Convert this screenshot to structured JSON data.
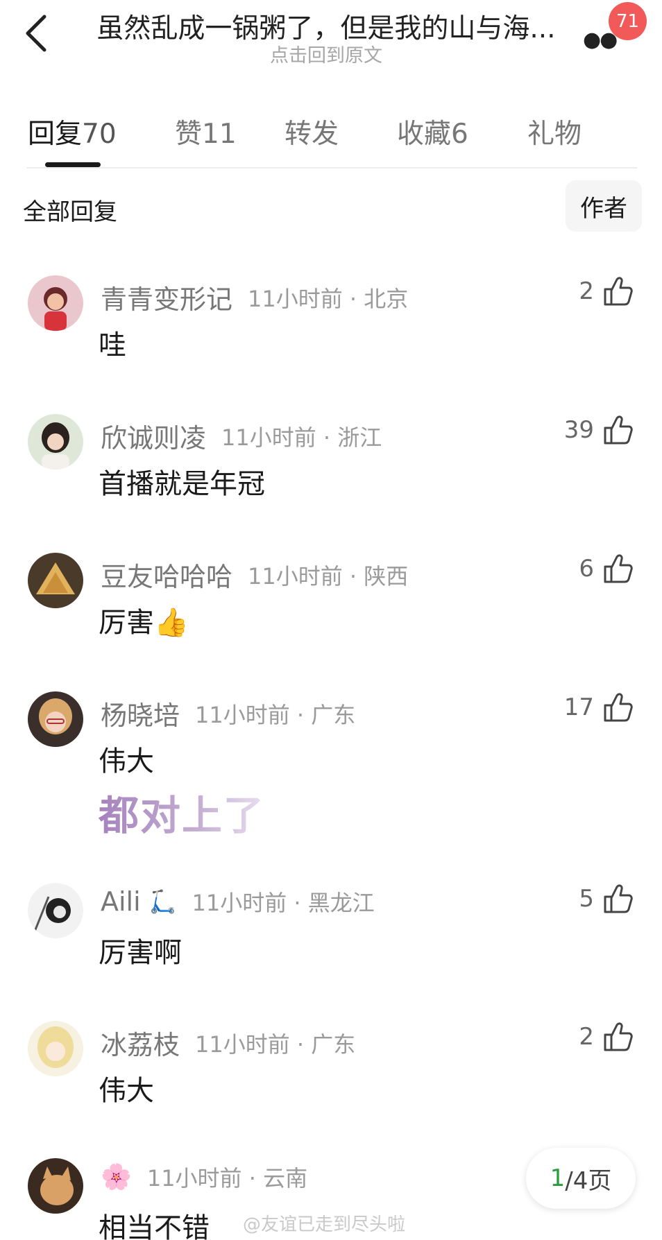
{
  "header": {
    "title": "虽然乱成一锅粥了，但是我的山与海...",
    "subtitle": "点击回到原文",
    "more_icon": "more-dots-icon",
    "notification_count": "71"
  },
  "tabs": [
    {
      "label": "回复",
      "count": "70"
    },
    {
      "label": "赞",
      "count": "11"
    },
    {
      "label": "转发",
      "count": ""
    },
    {
      "label": "收藏",
      "count": "6"
    },
    {
      "label": "礼物",
      "count": ""
    }
  ],
  "filter": {
    "all_label": "全部回复",
    "author_label": "作者"
  },
  "comments": [
    {
      "username": "青青变形记",
      "time_location": "11小时前 · 北京",
      "likes": "2",
      "text": "哇",
      "avatar": "cartoon-girl-avatar"
    },
    {
      "username": "欣诚则凌",
      "time_location": "11小时前 · 浙江",
      "likes": "39",
      "text": "首播就是年冠",
      "avatar": "woman-photo-avatar"
    },
    {
      "username": "豆友哈哈哈",
      "time_location": "11小时前 · 陕西",
      "likes": "6",
      "text": "厉害👍",
      "avatar": "zongzi-avatar"
    },
    {
      "username": "杨晓培",
      "time_location": "11小时前 · 广东",
      "likes": "17",
      "text": "伟大",
      "sticker_text": "都对上了",
      "avatar": "woman-glasses-avatar"
    },
    {
      "username": "Aili",
      "badge": "🛴",
      "time_location": "11小时前 · 黑龙江",
      "likes": "5",
      "text": "厉害啊",
      "avatar": "sketch-avatar"
    },
    {
      "username": "冰荔枝",
      "time_location": "11小时前 · 广东",
      "likes": "2",
      "text": "伟大",
      "avatar": "anime-girl-avatar"
    },
    {
      "username": "🌸",
      "time_location": "11小时前 · 云南",
      "likes": "",
      "text": "相当不错",
      "avatar": "cat-avatar"
    }
  ],
  "pager": {
    "current": "1",
    "total_suffix": "/4页"
  },
  "watermark": "@友谊已走到尽头啦"
}
